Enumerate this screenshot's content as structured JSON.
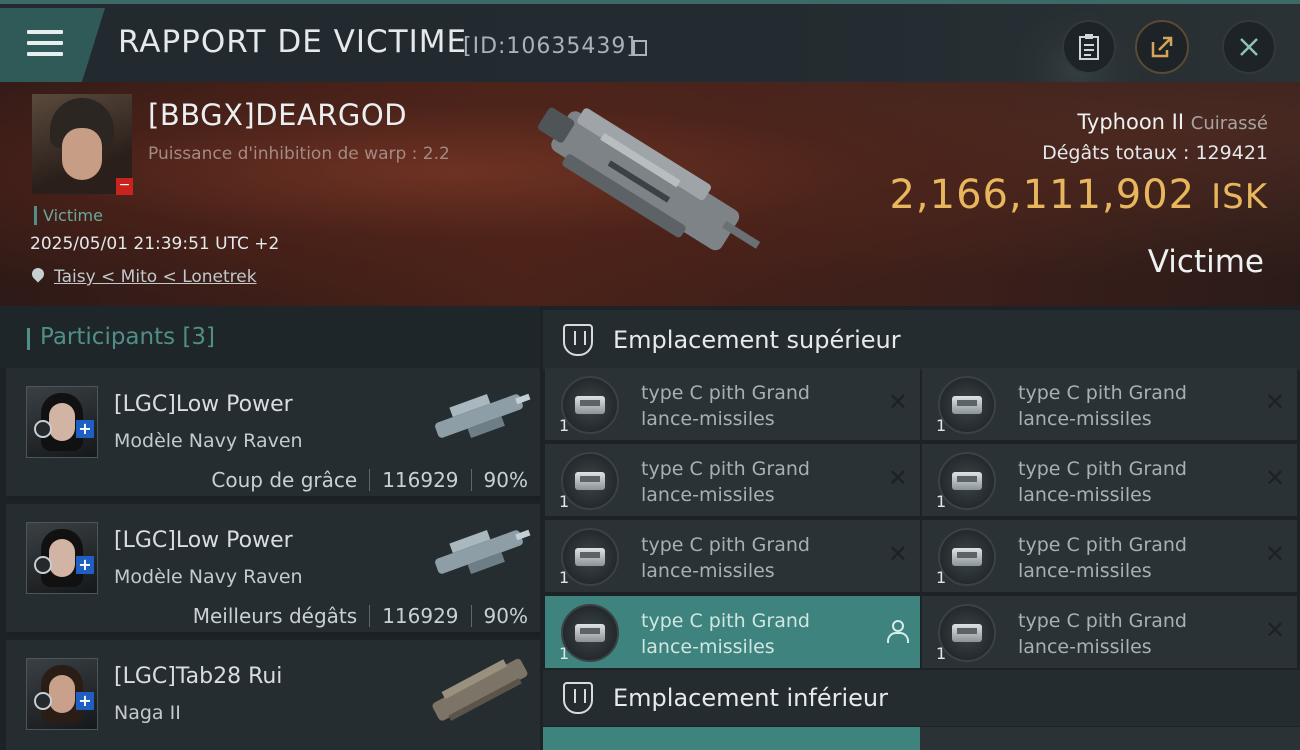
{
  "header": {
    "title": "RAPPORT DE VICTIME",
    "report_id": "[ID:10635439]",
    "buttons": [
      "clipboard-icon",
      "share-icon",
      "close-icon"
    ]
  },
  "victim": {
    "name": "[BBGX]DEARGOD",
    "warp_strength": "Puissance d'inhibition de warp : 2.2",
    "role_label": "Victime",
    "datetime": "2025/05/01 21:39:51 UTC +2",
    "location": "Taisy < Mito < Lonetrek",
    "ship_name": "Typhoon II",
    "ship_class": "Cuirassé",
    "total_damage_label": "Dégâts totaux :",
    "total_damage": "129421",
    "isk_value": "2,166,111,902",
    "isk_unit": "ISK",
    "result_label": "Victime"
  },
  "participants": {
    "title": "Participants",
    "count": "[3]",
    "items": [
      {
        "name": "[LGC]Low Power",
        "ship": "Modèle Navy Raven",
        "tag": "Coup de grâce",
        "damage": "116929",
        "percent": "90%"
      },
      {
        "name": "[LGC]Low Power",
        "ship": "Modèle Navy Raven",
        "tag": "Meilleurs dégâts",
        "damage": "116929",
        "percent": "90%"
      },
      {
        "name": "[LGC]Tab28 Rui",
        "ship": "Naga II"
      }
    ]
  },
  "slots": {
    "upper_title": "Emplacement supérieur",
    "lower_title": "Emplacement inférieur",
    "upper": [
      {
        "qty": "1",
        "name1": "type C pith Grand",
        "name2": "lance-missiles",
        "state": "destroyed"
      },
      {
        "qty": "1",
        "name1": "type C pith Grand",
        "name2": "lance-missiles",
        "state": "destroyed"
      },
      {
        "qty": "1",
        "name1": "type C pith Grand",
        "name2": "lance-missiles",
        "state": "destroyed"
      },
      {
        "qty": "1",
        "name1": "type C pith Grand",
        "name2": "lance-missiles",
        "state": "destroyed"
      },
      {
        "qty": "1",
        "name1": "type C pith Grand",
        "name2": "lance-missiles",
        "state": "destroyed"
      },
      {
        "qty": "1",
        "name1": "type C pith Grand",
        "name2": "lance-missiles",
        "state": "destroyed"
      },
      {
        "qty": "1",
        "name1": "type C pith Grand",
        "name2": "lance-missiles",
        "state": "dropped"
      },
      {
        "qty": "1",
        "name1": "type C pith Grand",
        "name2": "lance-missiles",
        "state": "destroyed"
      }
    ]
  },
  "colors": {
    "accent": "#4f8f87",
    "isk": "#e8b65d",
    "active_slot": "#3e837d"
  }
}
